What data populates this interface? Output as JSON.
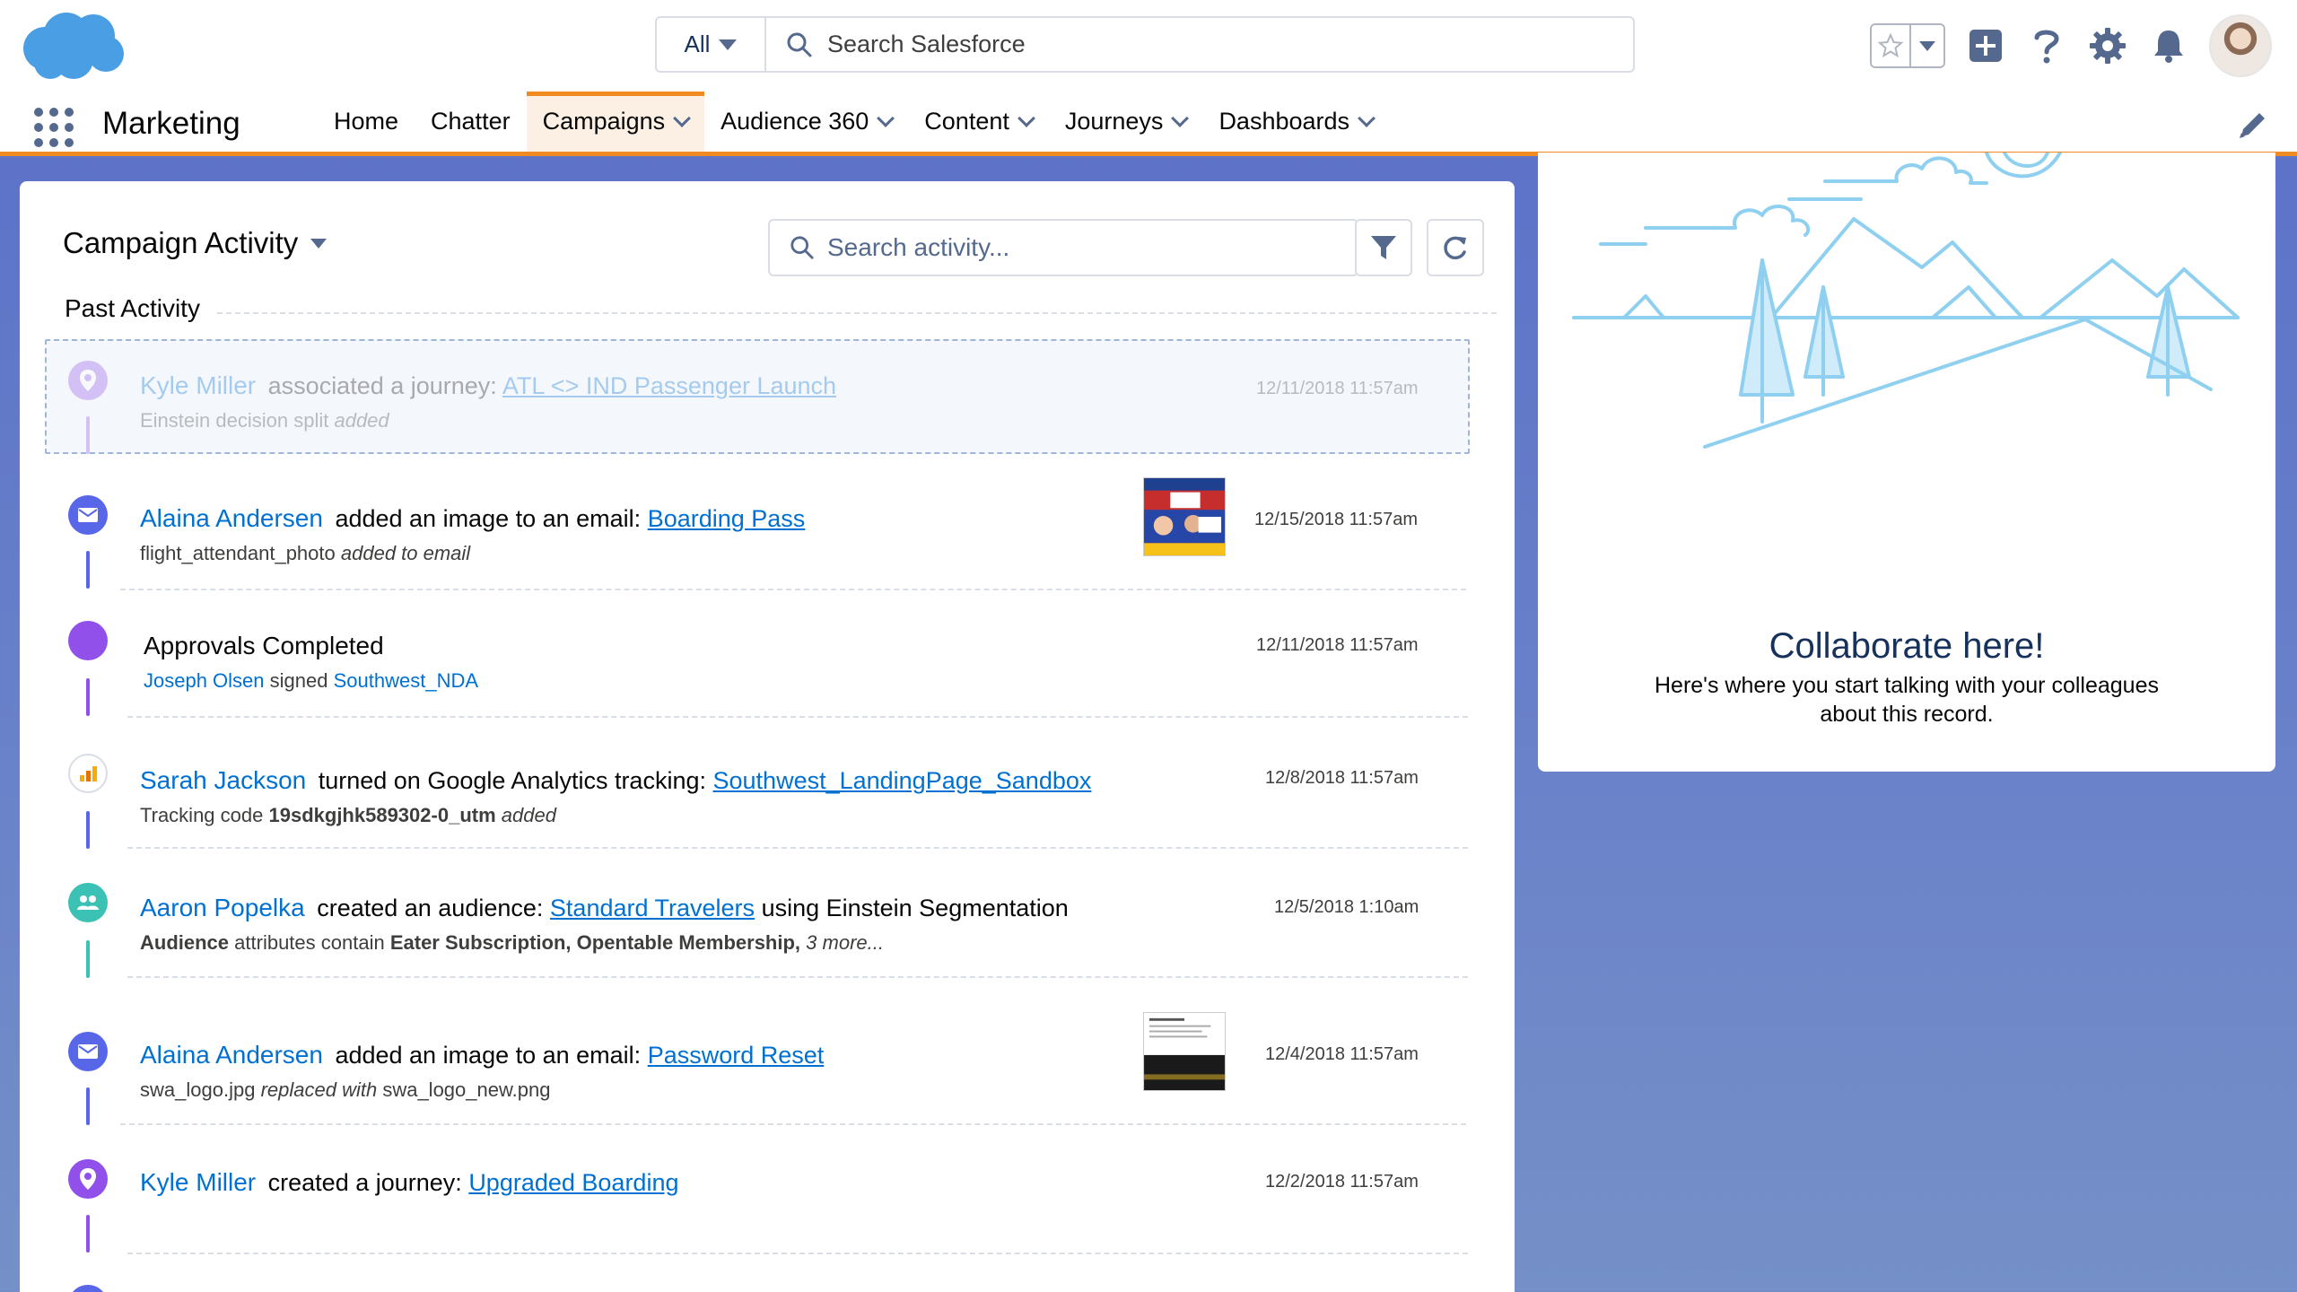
{
  "global_header": {
    "search_scope": "All",
    "search_placeholder": "Search Salesforce"
  },
  "app_nav": {
    "app_name": "Marketing",
    "items": [
      {
        "label": "Home"
      },
      {
        "label": "Chatter"
      },
      {
        "label": "Campaigns"
      },
      {
        "label": "Audience 360"
      },
      {
        "label": "Content"
      },
      {
        "label": "Journeys"
      },
      {
        "label": "Dashboards"
      }
    ]
  },
  "activity": {
    "title": "Campaign Activity",
    "search_placeholder": "Search activity...",
    "section_label": "Past Activity",
    "items": [
      {
        "actor": "Kyle Miller",
        "action": "associated a journey:",
        "link": "ATL <> IND Passenger Launch",
        "sub_text": "Einstein decision split",
        "sub_em": "added",
        "date": "12/11/2018 11:57am"
      },
      {
        "actor": "Alaina Andersen",
        "action": "added an image to an email:",
        "link": "Boarding Pass",
        "sub_text": "flight_attendant_photo",
        "sub_em": "added to email",
        "date": "12/15/2018 11:57am"
      },
      {
        "title": "Approvals Completed",
        "sub_actor": "Joseph Olsen",
        "sub_action": "signed",
        "sub_link": "Southwest_NDA",
        "date": "12/11/2018 11:57am"
      },
      {
        "actor": "Sarah Jackson",
        "action": "turned on Google Analytics tracking:",
        "link": "Southwest_LandingPage_Sandbox",
        "sub_prefix": "Tracking code",
        "sub_bold": "19sdkgjhk589302-0_utm",
        "sub_em": "added",
        "date": "12/8/2018 11:57am"
      },
      {
        "actor": "Aaron Popelka",
        "action": "created an audience:",
        "link": "Standard Travelers",
        "action_after": "using Einstein Segmentation",
        "sub_bold1": "Audience",
        "sub_mid": "attributes contain",
        "sub_bold2": "Eater Subscription, Opentable Membership,",
        "sub_em": "3 more...",
        "date": "12/5/2018 1:10am"
      },
      {
        "actor": "Alaina Andersen",
        "action": "added an image to an email:",
        "link": "Password Reset",
        "sub_text": "swa_logo.jpg",
        "sub_em": "replaced with",
        "sub_after": "swa_logo_new.png",
        "date": "12/4/2018 11:57am"
      },
      {
        "actor": "Kyle Miller",
        "action": "created a journey:",
        "link": "Upgraded Boarding",
        "date": "12/2/2018 11:57am"
      }
    ]
  },
  "collaborate": {
    "title": "Collaborate here!",
    "text": "Here's where you start talking with your colleagues about this record."
  },
  "colors": {
    "brand_blue": "#0070d2",
    "nav_accent": "#ef8b22",
    "background": "#6a82c9",
    "email_icon": "#5867e8",
    "approval_icon": "#9050e9",
    "audience_icon": "#3bc2b5",
    "journey_icon": "#9050e9"
  }
}
